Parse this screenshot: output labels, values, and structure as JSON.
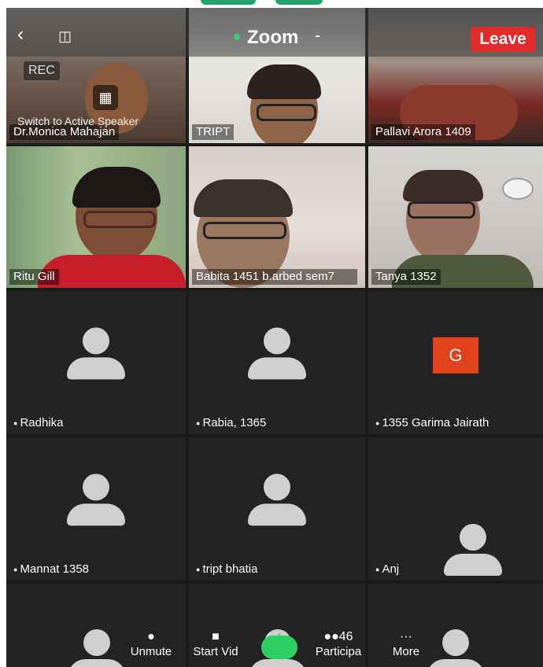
{
  "meeting": {
    "title": "Zoom",
    "leave_label": "Leave",
    "rec_label": "REC",
    "switch_label": "Switch to Active Speaker"
  },
  "tiles": [
    {
      "name": "Dr.Monica Mahajan",
      "type": "video"
    },
    {
      "name": "TRIPT",
      "type": "video"
    },
    {
      "name": "Pallavi Arora 1409",
      "type": "video"
    },
    {
      "name": "Ritu Gill",
      "type": "video"
    },
    {
      "name": "Babita 1451 b.arbed sem7",
      "type": "video"
    },
    {
      "name": "Tanya 1352",
      "type": "video"
    },
    {
      "name": "Radhika",
      "type": "avatar"
    },
    {
      "name": "Rabia, 1365",
      "type": "avatar"
    },
    {
      "name": "1355 Garima Jairath",
      "type": "letter",
      "letter": "G"
    },
    {
      "name": "Mannat 1358",
      "type": "avatar"
    },
    {
      "name": "tript bhatia",
      "type": "avatar"
    },
    {
      "name": "Anj",
      "type": "avatar"
    }
  ],
  "toolbar": {
    "unmute": "Unmute",
    "start_video": "Start Vid",
    "share": "Share",
    "participants": "Participa",
    "participants_count": "46",
    "more": "More"
  },
  "colors": {
    "leave": "#e02b2b",
    "share": "#2ecf63",
    "letter_avatar": "#e0431b",
    "background": "#1c1c1c"
  }
}
